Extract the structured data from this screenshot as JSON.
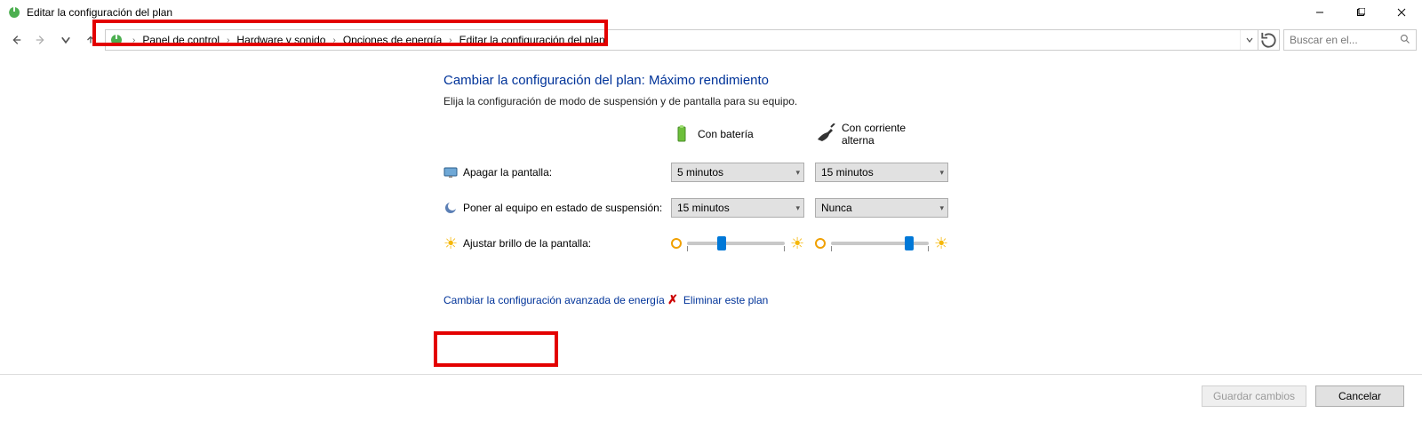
{
  "window": {
    "title": "Editar la configuración del plan"
  },
  "breadcrumb": {
    "items": [
      "Panel de control",
      "Hardware y sonido",
      "Opciones de energía",
      "Editar la configuración del plan"
    ]
  },
  "search": {
    "placeholder": "Buscar en el..."
  },
  "page": {
    "heading": "Cambiar la configuración del plan: Máximo rendimiento",
    "subheading": "Elija la configuración de modo de suspensión y de pantalla para su equipo."
  },
  "columns": {
    "battery_label": "Con batería",
    "ac_label_line1": "Con corriente",
    "ac_label_line2": "alterna"
  },
  "rows": {
    "display_off": {
      "label": "Apagar la pantalla:",
      "battery_value": "5 minutos",
      "ac_value": "15 minutos"
    },
    "sleep": {
      "label": "Poner al equipo en estado de suspensión:",
      "battery_value": "15 minutos",
      "ac_value": "Nunca"
    },
    "brightness": {
      "label": "Ajustar brillo de la pantalla:",
      "battery_percent": 35,
      "ac_percent": 80
    }
  },
  "links": {
    "advanced": "Cambiar la configuración avanzada de energía",
    "delete_plan": "Eliminar este plan"
  },
  "buttons": {
    "save": "Guardar cambios",
    "cancel": "Cancelar"
  }
}
